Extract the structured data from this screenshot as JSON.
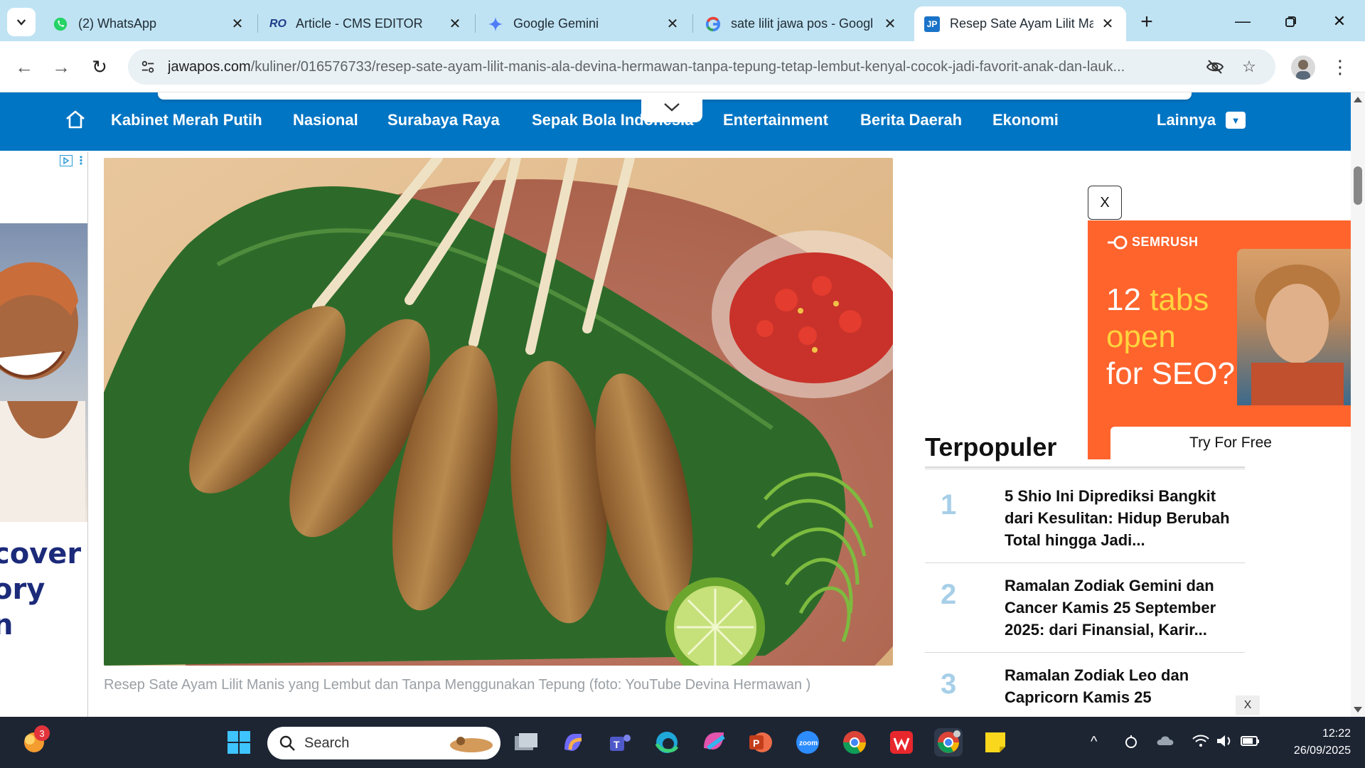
{
  "browser": {
    "tabs": [
      {
        "title": "(2) WhatsApp",
        "icon": "whatsapp-icon",
        "active": false
      },
      {
        "title": "Article - CMS EDITOR",
        "icon": "cms-icon",
        "active": false
      },
      {
        "title": "Google Gemini",
        "icon": "gemini-icon",
        "active": false
      },
      {
        "title": "sate lilit jawa pos - Googl",
        "icon": "google-icon",
        "active": false
      },
      {
        "title": "Resep Sate Ayam Lilit Ma",
        "icon": "jawapos-icon",
        "active": true
      }
    ],
    "url_domain": "jawapos.com",
    "url_path": "/kuliner/016576733/resep-sate-ayam-lilit-manis-ala-devina-hermawan-tanpa-tepung-tetap-lembut-kenyal-cocok-jadi-favorit-anak-dan-lauk..."
  },
  "site": {
    "nav": [
      "Kabinet Merah Putih",
      "Nasional",
      "Surabaya Raya",
      "Sepak Bola Indonesia",
      "Entertainment",
      "Berita Daerah",
      "Ekonomi"
    ],
    "nav_more": "Lainnya",
    "accent": "#0075c4"
  },
  "left_ad": {
    "text_lines": [
      "cover",
      "ory",
      "n"
    ]
  },
  "article": {
    "caption": "Resep Sate Ayam Lilit Manis yang Lembut dan Tanpa Menggunakan Tepung (foto: YouTube Devina Hermawan )"
  },
  "sidebar_ad": {
    "close_label": "X",
    "brand": "SEMRUSH",
    "headline_1": "12",
    "headline_2": "tabs",
    "headline_3": "open",
    "headline_4": "for SEO?",
    "cta": "Try For Free"
  },
  "popular": {
    "title": "Terpopuler",
    "items": [
      {
        "rank": "1",
        "text": "5 Shio Ini Diprediksi Bangkit dari Kesulitan: Hidup Berubah Total hingga Jadi..."
      },
      {
        "rank": "2",
        "text": "Ramalan Zodiak Gemini dan Cancer Kamis 25 September 2025: dari Finansial, Karir..."
      },
      {
        "rank": "3",
        "text": "Ramalan Zodiak Leo dan Capricorn Kamis 25"
      }
    ],
    "small_close": "X"
  },
  "taskbar": {
    "search_label": "Search",
    "notification_count": "3",
    "time": "12:22",
    "date": "26/09/2025"
  }
}
